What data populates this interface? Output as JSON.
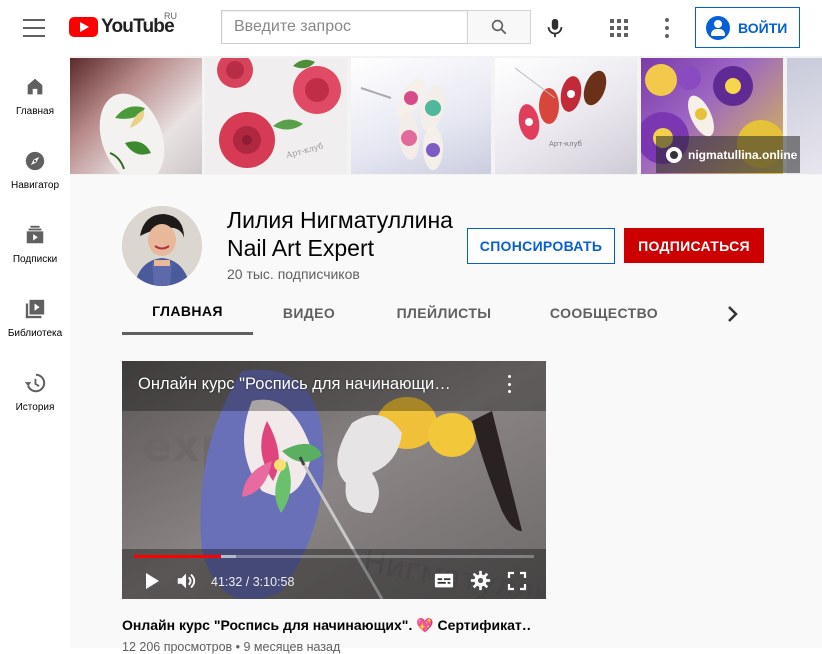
{
  "header": {
    "logo_text": "YouTube",
    "region": "RU",
    "search_placeholder": "Введите запрос",
    "signin_label": "ВОЙТИ"
  },
  "sidebar": {
    "items": [
      {
        "label": "Главная",
        "icon": "home-icon"
      },
      {
        "label": "Навигатор",
        "icon": "compass-icon"
      },
      {
        "label": "Подписки",
        "icon": "subscriptions-icon"
      },
      {
        "label": "Библиотека",
        "icon": "library-icon"
      },
      {
        "label": "История",
        "icon": "history-icon"
      }
    ]
  },
  "banner": {
    "link_text": "nigmatullina.online"
  },
  "channel": {
    "name": "Лилия Нигматуллина Nail Art Expert",
    "subscribers": "20 тыс. подписчиков",
    "sponsor_label": "СПОНСИРОВАТЬ",
    "subscribe_label": "ПОДПИСАТЬСЯ"
  },
  "tabs": [
    {
      "label": "ГЛАВНАЯ",
      "active": true
    },
    {
      "label": "ВИДЕО",
      "active": false
    },
    {
      "label": "ПЛЕЙЛИСТЫ",
      "active": false
    },
    {
      "label": "СООБЩЕСТВО",
      "active": false
    }
  ],
  "player": {
    "overlay_title": "Онлайн курс \"Роспись для начинающи…",
    "time": "41:32 / 3:10:58",
    "played_fraction": 0.218,
    "buffered_fraction": 0.255
  },
  "video": {
    "title": "Онлайн курс \"Роспись для начинающих\". 💖 Сертификат…",
    "meta": "12 206 просмотров • 9 месяцев назад"
  },
  "colors": {
    "accent_blue": "#065fd4",
    "subscribe_red": "#cc0000",
    "logo_red": "#ff0000"
  }
}
